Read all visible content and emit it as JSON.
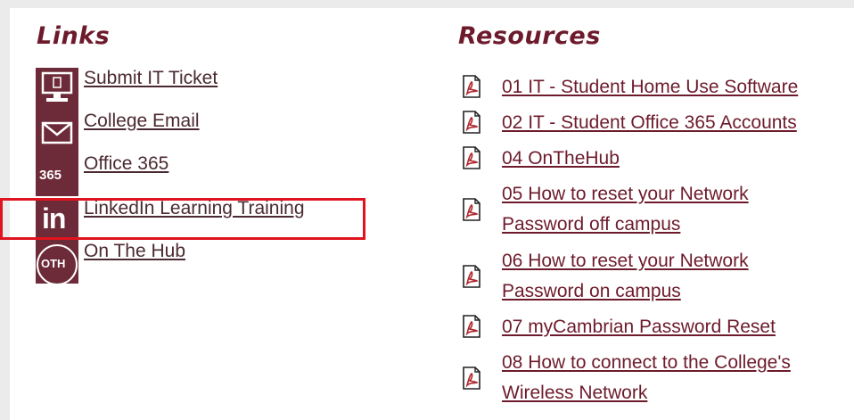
{
  "links": {
    "title": "Links",
    "items": [
      {
        "label": "Submit IT Ticket",
        "icon": "it-ticket-monitor-icon"
      },
      {
        "label": "College Email",
        "icon": "email-envelope-icon"
      },
      {
        "label": "Office 365",
        "icon": "office-365-icon",
        "icon_text": "365"
      },
      {
        "label": "LinkedIn Learning Training",
        "icon": "linkedin-icon",
        "icon_text": "in"
      },
      {
        "label": "On The Hub",
        "icon": "onthehub-icon",
        "icon_text": "OTH"
      }
    ]
  },
  "resources": {
    "title": "Resources",
    "items": [
      {
        "line1": "01 IT - Student Home Use Software",
        "line2": ""
      },
      {
        "line1": "02 IT - Student Office 365 Accounts",
        "line2": ""
      },
      {
        "line1": "04 OnTheHub",
        "line2": ""
      },
      {
        "line1": "05 How to reset your Network",
        "line2": "Password off campus"
      },
      {
        "line1": "06 How to reset your Network",
        "line2": "Password on campus"
      },
      {
        "line1": "07 myCambrian Password Reset",
        "line2": ""
      },
      {
        "line1": "08 How to connect to the College's",
        "line2": "Wireless Network"
      }
    ]
  },
  "colors": {
    "brand": "#6d1b2c",
    "icon_bg": "#6d2a38",
    "highlight": "#e0141e"
  }
}
